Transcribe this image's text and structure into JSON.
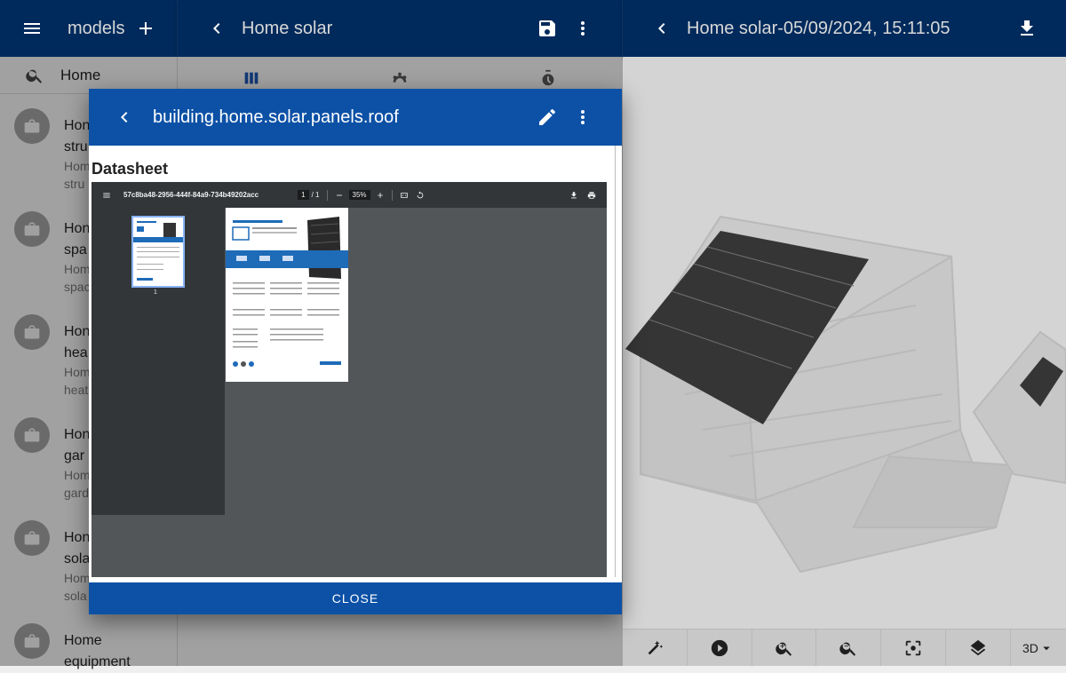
{
  "left_bar": {
    "title": "models"
  },
  "mid_bar": {
    "title": "Home solar"
  },
  "right_bar": {
    "title": "Home solar-05/09/2024, 15:11:05"
  },
  "search": {
    "value": "Home"
  },
  "list": {
    "items": [
      {
        "title": "Hon",
        "title2": "stru",
        "sub": "Hom",
        "sub2": "stru"
      },
      {
        "title": "Hon",
        "title2": "spa",
        "sub": "Hom",
        "sub2": "spac"
      },
      {
        "title": "Hon",
        "title2": "hea",
        "sub": "Hom",
        "sub2": "heat"
      },
      {
        "title": "Hon",
        "title2": "gar",
        "sub": "Hom",
        "sub2": "gard"
      },
      {
        "title": "Hon",
        "title2": "sola",
        "sub": "Hom",
        "sub2": "sola"
      },
      {
        "title": "Home",
        "title2": "equipment"
      }
    ]
  },
  "dialog": {
    "title": "building.home.solar.panels.roof",
    "section": "Datasheet",
    "close_label": "CLOSE"
  },
  "pdf": {
    "filename": "57c8ba48-2956-444f-84a9-734b49202acc",
    "page_current": "1",
    "page_total": "1",
    "zoom": "35%",
    "thumb_label": "1"
  },
  "view3d": {
    "mode": "3D"
  },
  "colors": {
    "topbar": "#002a5c",
    "dialog_header": "#0c51a6",
    "accent": "#1a56b0"
  }
}
